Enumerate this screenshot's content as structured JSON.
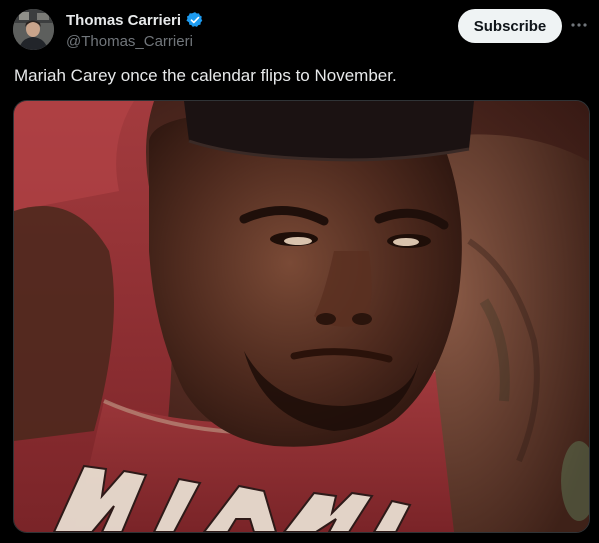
{
  "author": {
    "display_name": "Thomas Carrieri",
    "handle": "@Thomas_Carrieri",
    "verified": true,
    "avatar_icon": "avatar-photo"
  },
  "actions": {
    "subscribe_label": "Subscribe",
    "more_icon": "more-horizontal-icon"
  },
  "tweet": {
    "text": "Mariah Carey once the calendar flips to November."
  },
  "media": {
    "jersey_lettering": "MIAMI"
  },
  "colors": {
    "background": "#000000",
    "text_primary": "#e7e9ea",
    "text_secondary": "#71767b",
    "verified_blue": "#1d9bf0",
    "button_bg": "#eff3f4",
    "button_text": "#0f1419",
    "jersey_red": "#8e2a2e"
  }
}
